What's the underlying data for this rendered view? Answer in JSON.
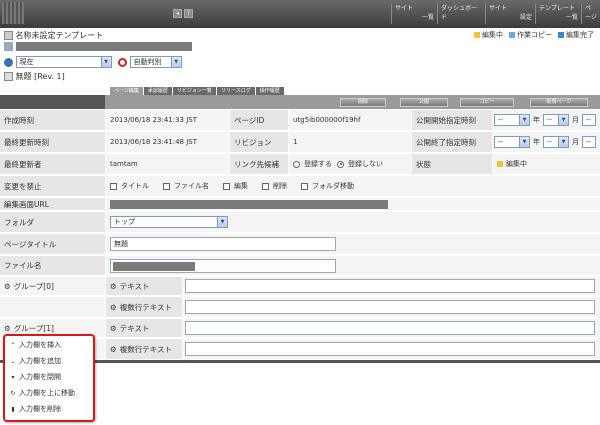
{
  "topbar": {
    "nav": [
      {
        "top": "サイト",
        "sub": "一覧"
      },
      {
        "top": "ダッシュボード",
        "sub": ""
      },
      {
        "top": "サイト",
        "sub": "設定"
      },
      {
        "top": "テンプレート",
        "sub": "一覧"
      },
      {
        "top": "ページ",
        "sub": ""
      }
    ]
  },
  "header": {
    "template_name": "名称未設定テンプレート",
    "version_select": "現在",
    "auto_select": "自動判別",
    "page_title": "無題 [Rev. 1]"
  },
  "legend": [
    {
      "label": "編集中",
      "color": "#f1c232"
    },
    {
      "label": "作業コピー",
      "color": "#6fa8dc"
    },
    {
      "label": "編集完了",
      "color": "#3d85c6"
    }
  ],
  "tabs": [
    "ページ編集",
    "承認履歴",
    "リビジョン一覧",
    "リリースログ",
    "操作履歴"
  ],
  "actions": [
    "削除",
    "公開",
    "コピー",
    "新規ページ"
  ],
  "rows": {
    "created": {
      "label": "作成時刻",
      "value": "2013/06/18 23:41:33 JST",
      "label2": "ページID",
      "value2": "utg5ib000000f19hf",
      "label3": "公開開始指定時刻"
    },
    "updated": {
      "label": "最終更新時刻",
      "value": "2013/06/18 23:41:48 JST",
      "label2": "リビジョン",
      "value2": "1",
      "label3": "公開終了指定時刻"
    },
    "updater": {
      "label": "最終更新者",
      "value": "tamtam",
      "label2": "リンク先候補",
      "radio1": "登録する",
      "radio2": "登録しない",
      "label3": "状態",
      "status": "編集中"
    },
    "lock": {
      "label": "変更を禁止",
      "checks": [
        "タイトル",
        "ファイル名",
        "編集",
        "削除",
        "フォルダ移動"
      ]
    },
    "edit_url": {
      "label": "編集画面URL"
    },
    "folder": {
      "label": "フォルダ",
      "value": "トップ"
    },
    "page_title": {
      "label": "ページタイトル",
      "value": "無題"
    },
    "filename": {
      "label": "ファイル名"
    }
  },
  "date_fields": {
    "year": "年",
    "month": "月",
    "blank": "--"
  },
  "groups": [
    {
      "label": "グループ[0]",
      "fields": [
        "テキスト",
        "複数行テキスト"
      ]
    },
    {
      "label": "グループ[1]",
      "fields": [
        "テキスト",
        "複数行テキスト"
      ]
    }
  ],
  "context_menu": [
    "入力欄を挿入",
    "入力欄を追加",
    "入力欄を閉開",
    "入力欄を上に移動",
    "入力欄を削除"
  ]
}
